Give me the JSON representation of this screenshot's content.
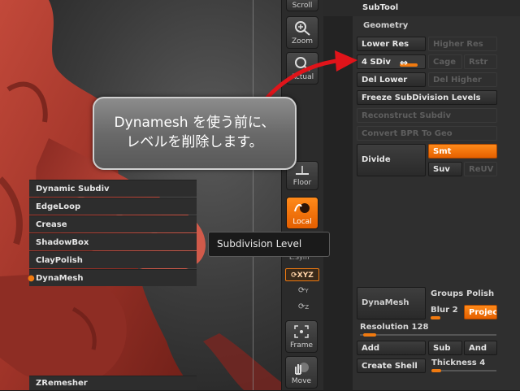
{
  "toolbar": {
    "scroll": "Scroll",
    "zoom": "Zoom",
    "actual": "Actual",
    "floor": "Floor",
    "local": "Local",
    "lsym": "L.Sym",
    "xyz": "XYZ",
    "y": "Y",
    "z": "Z",
    "frame": "Frame",
    "move": "Move"
  },
  "panel": {
    "title": "SubTool",
    "geometry": "Geometry",
    "lower_res": "Lower Res",
    "higher_res": "Higher Res",
    "sdiv": "4 SDiv",
    "cage": "Cage",
    "rstr": "Rstr",
    "del_lower": "Del Lower",
    "del_higher": "Del Higher",
    "freeze": "Freeze SubDivision Levels",
    "reconstruct": "Reconstruct Subdiv",
    "convert_bpr": "Convert BPR To Geo",
    "divide": "Divide",
    "smt": "Smt",
    "suv": "Suv",
    "reuv": "ReUV",
    "dynamic_subdiv": "Dynamic Subdiv",
    "edgeloop": "EdgeLoop",
    "crease": "Crease",
    "shadowbox": "ShadowBox",
    "claypolish": "ClayPolish",
    "dynamesh_section": "DynaMesh",
    "dynamesh_btn": "DynaMesh",
    "groups": "Groups",
    "polish": "Polish",
    "blur": "Blur 2",
    "project": "Projec",
    "resolution": "Resolution 128",
    "add": "Add",
    "sub": "Sub",
    "and": "And",
    "create_shell": "Create Shell",
    "thickness": "Thickness 4",
    "zremesher": "ZRemesher"
  },
  "callout": {
    "line1": "Dynamesh を使う前に、",
    "line2": "レベルを削除します。"
  },
  "tooltip": "Subdivision Level",
  "colors": {
    "accent": "#f07a10",
    "arrow": "#e0141a",
    "model": "#a8362c"
  }
}
